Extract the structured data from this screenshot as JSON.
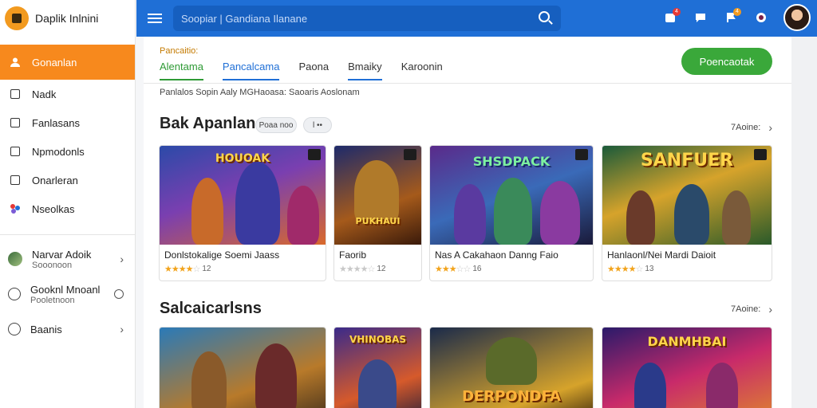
{
  "brand": {
    "name": "Daplik Inlnini"
  },
  "search": {
    "placeholder": "Soopiar | Gandiana Ilanane"
  },
  "header": {
    "badge1": "4",
    "badge2": "4"
  },
  "sidebar": {
    "items": [
      {
        "label": "Gonanlan"
      },
      {
        "label": "Nadk"
      },
      {
        "label": "Fanlasans"
      },
      {
        "label": "Npmodonls"
      },
      {
        "label": "Onarleran"
      },
      {
        "label": "Nseolkas"
      }
    ],
    "accounts": [
      {
        "title": "Narvar Adoik",
        "subtitle": "Sooonoon"
      },
      {
        "title": "Gooknl Mnoanl",
        "subtitle": "Pooletnoon"
      },
      {
        "title": "Baanis",
        "subtitle": ""
      }
    ]
  },
  "content": {
    "breadcrumb": "Pancaitio:",
    "tabs": [
      "Alentama",
      "Pancalcama",
      "Paona",
      "Bmaiky",
      "Karoonin"
    ],
    "cta_label": "Poencaotak",
    "subtext": "Panlalos Sopin Aaly MGHaoasa: Saoaris Aoslonam",
    "section1": {
      "title": "Bak Apanlan:",
      "pill1": "Poaa noo",
      "pill2": "l ••",
      "see_all": "7Aoine:"
    },
    "section2": {
      "title": "Salcaicarlsns",
      "see_all": "7Aoine:"
    },
    "cards_row1": [
      {
        "logo": "HOUOAK",
        "title": "Donlstokalige Soemi Jaass",
        "stars": 4,
        "rating": "12"
      },
      {
        "logo": "PUKHAUI",
        "title": "Faorib",
        "stars": 0,
        "rating": "12"
      },
      {
        "logo": "SHSDPACK",
        "title": "Nas A Cakahaon Danng Faio",
        "stars": 3,
        "rating": "16"
      },
      {
        "logo": "SANFUER",
        "title": "Hanlaonl/Nei Mardi Daioit",
        "stars": 4,
        "rating": "13"
      }
    ],
    "cards_row2": [
      {
        "logo": ""
      },
      {
        "logo": "VHINOBAS"
      },
      {
        "logo": "DERPONDFA"
      },
      {
        "logo": "DANMHBAI"
      }
    ]
  },
  "colors": {
    "header": "#1f6fd6",
    "accent": "#f7891d",
    "cta": "#3aa83a",
    "star": "#f2a31b"
  }
}
